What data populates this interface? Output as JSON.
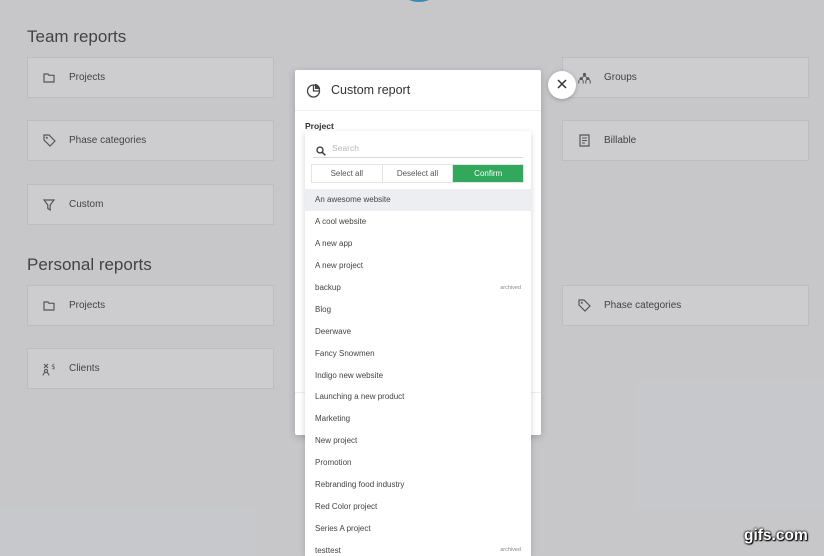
{
  "team_reports": {
    "title": "Team reports",
    "cards": [
      {
        "label": "Projects",
        "icon": "folder-icon"
      },
      {
        "label": "Groups",
        "icon": "group-icon"
      },
      {
        "label": "Phase categories",
        "icon": "tag-icon"
      },
      {
        "label": "Billable",
        "icon": "invoice-icon"
      },
      {
        "label": "Custom",
        "icon": "filter-icon"
      }
    ]
  },
  "personal_reports": {
    "title": "Personal reports",
    "cards": [
      {
        "label": "Projects",
        "icon": "folder-icon"
      },
      {
        "label": "Phase categories",
        "icon": "tag-icon"
      },
      {
        "label": "Clients",
        "icon": "clients-icon"
      }
    ]
  },
  "modal": {
    "title": "Custom report",
    "project_label": "Project"
  },
  "dropdown": {
    "search_placeholder": "Search",
    "select_all": "Select all",
    "deselect_all": "Deselect all",
    "confirm": "Confirm",
    "confirm_color": "#31a85c",
    "items": [
      {
        "label": "An awesome website",
        "tag": ""
      },
      {
        "label": "A cool website",
        "tag": ""
      },
      {
        "label": "A new app",
        "tag": ""
      },
      {
        "label": "A new project",
        "tag": ""
      },
      {
        "label": "backup",
        "tag": "archived"
      },
      {
        "label": "Blog",
        "tag": ""
      },
      {
        "label": "Deerwave",
        "tag": ""
      },
      {
        "label": "Fancy Snowmen",
        "tag": ""
      },
      {
        "label": "Indigo new website",
        "tag": ""
      },
      {
        "label": "Launching a new product",
        "tag": ""
      },
      {
        "label": "Marketing",
        "tag": ""
      },
      {
        "label": "New project",
        "tag": ""
      },
      {
        "label": "Promotion",
        "tag": ""
      },
      {
        "label": "Rebranding food industry",
        "tag": ""
      },
      {
        "label": "Red Color project",
        "tag": ""
      },
      {
        "label": "Series A project",
        "tag": ""
      },
      {
        "label": "testtest",
        "tag": "archived"
      }
    ]
  },
  "watermark": "gifs.com"
}
